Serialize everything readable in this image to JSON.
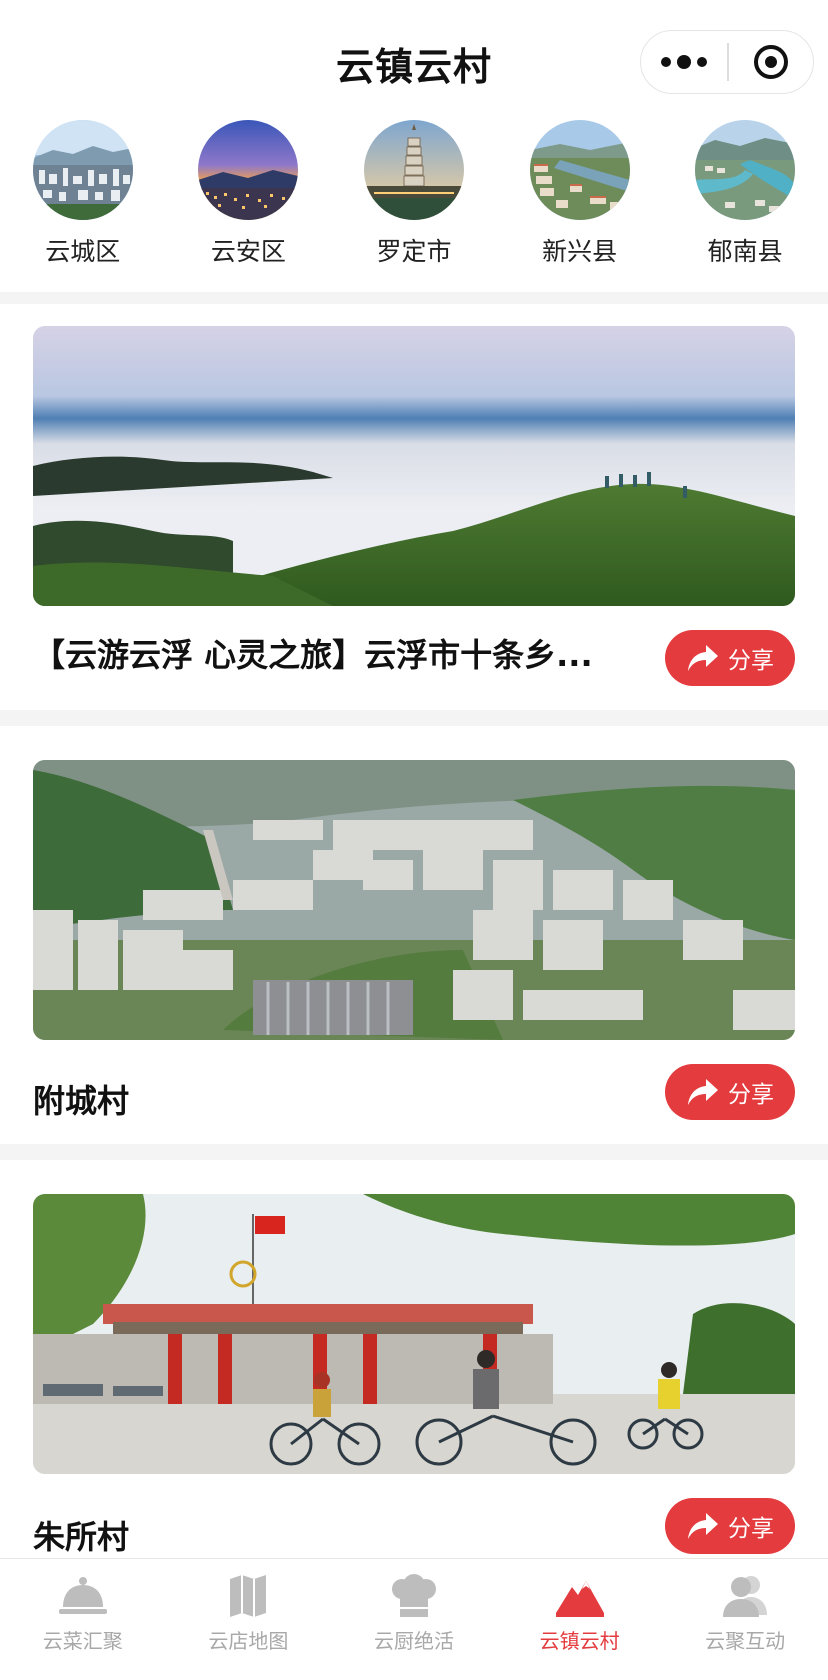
{
  "navbar": {
    "title": "云镇云村",
    "more_icon": "more-dots-icon",
    "close_icon": "target-circle-icon"
  },
  "districts": [
    {
      "label": "云城区",
      "image": "city-skyline-photo"
    },
    {
      "label": "云安区",
      "image": "sunset-town-photo"
    },
    {
      "label": "罗定市",
      "image": "pagoda-photo"
    },
    {
      "label": "新兴县",
      "image": "river-town-photo"
    },
    {
      "label": "郁南县",
      "image": "river-bend-photo"
    }
  ],
  "cards": [
    {
      "title": "【云游云浮 心灵之旅】云浮市十条乡...",
      "image": "sea-of-clouds-photo",
      "share_label": "分享"
    },
    {
      "title": "附城村",
      "image": "village-aerial-photo",
      "share_label": "分享"
    },
    {
      "title": "朱所村",
      "image": "village-gate-bicycles-photo",
      "share_label": "分享"
    }
  ],
  "tabbar": {
    "items": [
      {
        "label": "云菜汇聚",
        "icon": "cloche-icon",
        "active": false
      },
      {
        "label": "云店地图",
        "icon": "map-icon",
        "active": false
      },
      {
        "label": "云厨绝活",
        "icon": "chef-hat-icon",
        "active": false
      },
      {
        "label": "云镇云村",
        "icon": "mountain-icon",
        "active": true
      },
      {
        "label": "云聚互动",
        "icon": "users-icon",
        "active": false
      }
    ]
  },
  "colors": {
    "accent": "#e43b3f",
    "inactive_tab": "#a8a8a8",
    "title_text": "#111111",
    "section_gap": "#f4f4f4"
  }
}
